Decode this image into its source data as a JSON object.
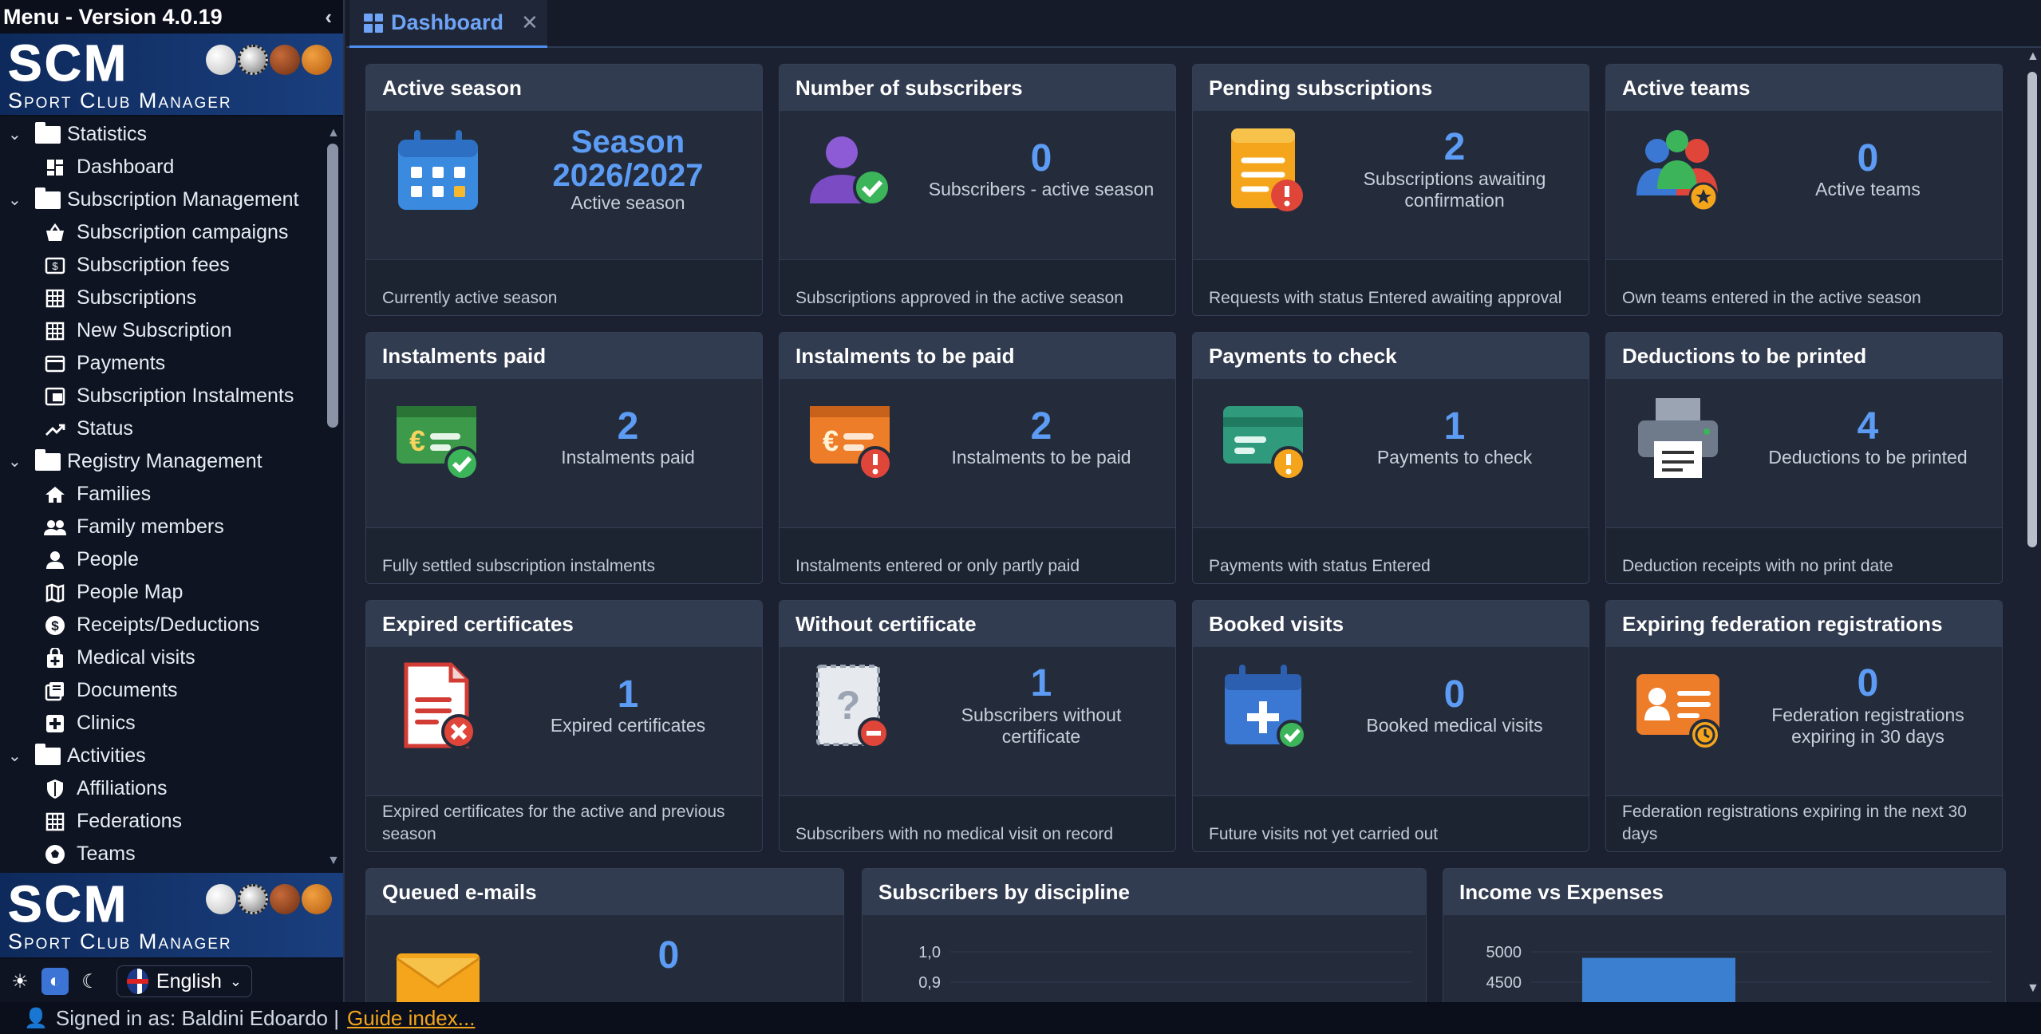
{
  "menu": {
    "title": "Menu - Version 4.0.19",
    "collapse_icon": "chevron-left-icon"
  },
  "logo": {
    "line1": "SCM",
    "line2": "Sport Club Manager"
  },
  "sidebar": {
    "groups": [
      {
        "label": "Statistics",
        "items": [
          {
            "label": "Dashboard",
            "icon": "dashboard-icon"
          }
        ]
      },
      {
        "label": "Subscription Management",
        "items": [
          {
            "label": "Subscription campaigns",
            "icon": "basket-icon"
          },
          {
            "label": "Subscription fees",
            "icon": "money-icon"
          },
          {
            "label": "Subscriptions",
            "icon": "table-icon"
          },
          {
            "label": "New Subscription",
            "icon": "table-icon"
          },
          {
            "label": "Payments",
            "icon": "card-icon"
          },
          {
            "label": "Subscription Instalments",
            "icon": "register-icon"
          },
          {
            "label": "Status",
            "icon": "trend-icon"
          }
        ]
      },
      {
        "label": "Registry Management",
        "items": [
          {
            "label": "Families",
            "icon": "home-icon"
          },
          {
            "label": "Family members",
            "icon": "users-icon"
          },
          {
            "label": "People",
            "icon": "user-icon"
          },
          {
            "label": "People Map",
            "icon": "map-icon"
          },
          {
            "label": "Receipts/Deductions",
            "icon": "dollar-icon"
          },
          {
            "label": "Medical visits",
            "icon": "medical-icon"
          },
          {
            "label": "Documents",
            "icon": "documents-icon"
          },
          {
            "label": "Clinics",
            "icon": "clinic-icon"
          }
        ]
      },
      {
        "label": "Activities",
        "items": [
          {
            "label": "Affiliations",
            "icon": "shield-icon"
          },
          {
            "label": "Federations",
            "icon": "table-icon"
          },
          {
            "label": "Teams",
            "icon": "football-icon"
          }
        ]
      }
    ]
  },
  "language": {
    "selected": "English"
  },
  "tab": {
    "label": "Dashboard"
  },
  "cards": [
    {
      "title": "Active season",
      "value": "Season 2026/2027",
      "label": "Active season",
      "footer": "Currently active season",
      "icon": "calendar-icon"
    },
    {
      "title": "Number of subscribers",
      "value": "0",
      "label": "Subscribers - active season",
      "footer": "Subscriptions approved in the active season",
      "icon": "user-check-icon"
    },
    {
      "title": "Pending subscriptions",
      "value": "2",
      "label": "Subscriptions awaiting confirmation",
      "footer": "Requests with status Entered awaiting approval",
      "icon": "document-warning-icon"
    },
    {
      "title": "Active teams",
      "value": "0",
      "label": "Active teams",
      "footer": "Own teams entered in the active season",
      "icon": "team-icon"
    },
    {
      "title": "Instalments paid",
      "value": "2",
      "label": "Instalments paid",
      "footer": "Fully settled subscription instalments",
      "icon": "euro-card-check-icon"
    },
    {
      "title": "Instalments to be paid",
      "value": "2",
      "label": "Instalments to be paid",
      "footer": "Instalments entered or only partly paid",
      "icon": "euro-card-warning-icon"
    },
    {
      "title": "Payments to check",
      "value": "1",
      "label": "Payments to check",
      "footer": "Payments with status Entered",
      "icon": "card-warning-icon"
    },
    {
      "title": "Deductions to be printed",
      "value": "4",
      "label": "Deductions to be printed",
      "footer": "Deduction receipts with no print date",
      "icon": "printer-icon"
    },
    {
      "title": "Expired certificates",
      "value": "1",
      "label": "Expired certificates",
      "footer": "Expired certificates for the active and previous season",
      "icon": "certificate-expired-icon"
    },
    {
      "title": "Without certificate",
      "value": "1",
      "label": "Subscribers without certificate",
      "footer": "Subscribers with no medical visit on record",
      "icon": "question-document-icon"
    },
    {
      "title": "Booked visits",
      "value": "0",
      "label": "Booked medical visits",
      "footer": "Future visits not yet carried out",
      "icon": "calendar-plus-icon"
    },
    {
      "title": "Expiring federation registrations",
      "value": "0",
      "label": "Federation registrations expiring in 30 days",
      "footer": "Federation registrations expiring in the next 30 days",
      "icon": "id-card-clock-icon"
    }
  ],
  "queued": {
    "title": "Queued e-mails",
    "value": "0",
    "icon": "envelope-icon"
  },
  "chart_data": [
    {
      "type": "bar",
      "title": "Subscribers by discipline",
      "y_ticks": [
        "1,0",
        "0,9"
      ],
      "ylim": [
        0,
        1
      ],
      "categories": [],
      "values": []
    },
    {
      "type": "bar",
      "title": "Income vs Expenses",
      "y_ticks": [
        "5000",
        "4500"
      ],
      "categories": [
        ""
      ],
      "values": [
        4900
      ],
      "color": "#3b7fd0"
    }
  ],
  "footer": {
    "signed_in": "Signed in as: Baldini Edoardo |",
    "guide": "Guide index..."
  },
  "colors": {
    "accent": "#5c9cf5",
    "warning": "#f4a51c",
    "danger": "#e0453a",
    "success": "#3bb55a"
  }
}
